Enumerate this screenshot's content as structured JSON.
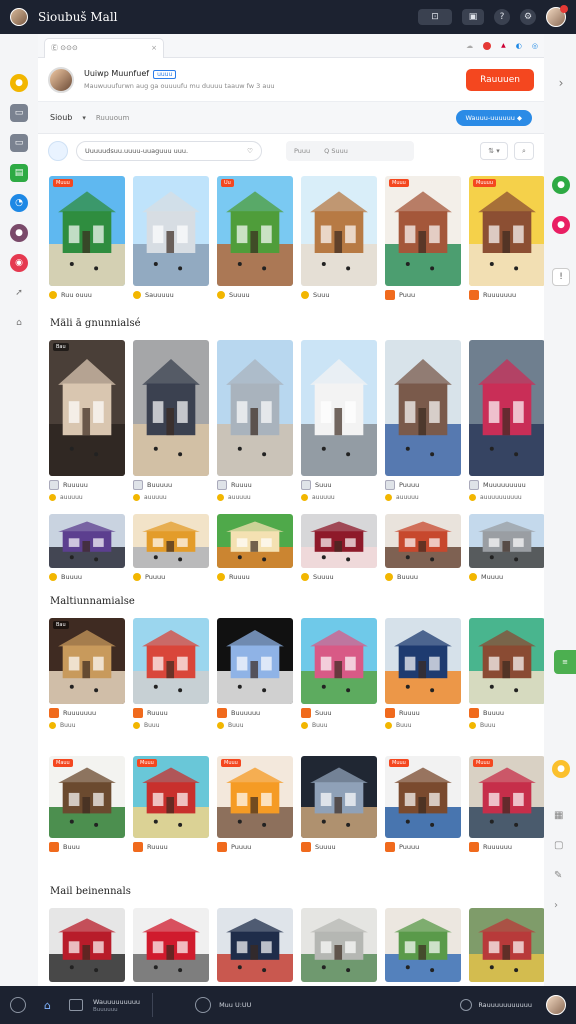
{
  "app": {
    "title": "Sioubuš Mall"
  },
  "topbar": {
    "btn1": "⊡",
    "btn2": "▣",
    "btn3": "?"
  },
  "tab": {
    "label": "Ⓔ ⊙⊙⊙",
    "close": "×"
  },
  "profile": {
    "name": "Uuiwp Muunfuef",
    "badge": "uuuu",
    "subtitle": "Mauwuuufurwn aug ga ouuuufu mu duuuu taauw fw 3 auu",
    "cta": "Rauuuen"
  },
  "subnav": {
    "selected": "Sioub",
    "second": "Ruuuoum",
    "pill": "Wauuu-uuuuuu"
  },
  "filters": {
    "search_placeholder": "Uuuuudsuu.uuuu-uuaguuu uuu.",
    "btn_a": "Puuu",
    "btn_b": "Q Suuu",
    "sort": "⇅ ▾",
    "search_icon": "⌕"
  },
  "row1": [
    {
      "tag": "Muuu",
      "label": "Ruu ouuu",
      "kind": "island",
      "icon": "coin"
    },
    {
      "tag": "",
      "label": "Sauuuuu",
      "kind": "city",
      "icon": "coin"
    },
    {
      "tag": "Uu",
      "label": "Suuuu",
      "kind": "tower",
      "icon": "coin"
    },
    {
      "tag": "",
      "label": "Suuu",
      "kind": "shop",
      "icon": "coin"
    },
    {
      "tag": "Muuu",
      "label": "Puuu",
      "kind": "market",
      "icon": "sq"
    },
    {
      "tag": "Muuuu",
      "label": "Ruuuuuuu",
      "kind": "stall",
      "icon": "sq"
    }
  ],
  "section1": "Mäli ā gnunnialsé",
  "row2": [
    {
      "tag": "Bau",
      "label": "Ruuuuu",
      "sub": "auuuuu",
      "kind": "mall-dark"
    },
    {
      "tag": "",
      "label": "Buuuuu",
      "sub": "auuuuu",
      "kind": "mall-front"
    },
    {
      "tag": "",
      "label": "Ruuuu",
      "sub": "auuuuu",
      "kind": "street"
    },
    {
      "tag": "",
      "label": "Suuu",
      "sub": "auuuuu",
      "kind": "church"
    },
    {
      "tag": "",
      "label": "Puuuu",
      "sub": "auuuuu",
      "kind": "plaza"
    },
    {
      "tag": "",
      "label": "Muuuuuuuuu",
      "sub": "auuuuuuuuuu",
      "kind": "grid"
    }
  ],
  "row3": [
    {
      "label": "Buuuu",
      "kind": "shop-a"
    },
    {
      "label": "Puuuu",
      "kind": "shop-b"
    },
    {
      "label": "Ruuuu",
      "kind": "shop-c"
    },
    {
      "label": "Suuuu",
      "kind": "shop-d"
    },
    {
      "label": "Buuuu",
      "kind": "shop-e"
    },
    {
      "label": "Muuuu",
      "kind": "shop-f"
    }
  ],
  "section2": "Maltiunnamialse",
  "row4": [
    {
      "tag": "Bau",
      "label": "Ruuuuuuu",
      "sub": "Buuu",
      "kind": "store-1"
    },
    {
      "tag": "",
      "label": "Ruuuu",
      "sub": "Buuu",
      "kind": "store-2"
    },
    {
      "tag": "",
      "label": "Buuuuuu",
      "sub": "Buuu",
      "kind": "kiosk"
    },
    {
      "tag": "",
      "label": "Suuu",
      "sub": "Buuu",
      "kind": "candy"
    },
    {
      "tag": "",
      "label": "Ruuuu",
      "sub": "Buuu",
      "kind": "store-5"
    },
    {
      "tag": "",
      "label": "Buuuu",
      "sub": "Buuu",
      "kind": "store-6"
    }
  ],
  "row5": [
    {
      "tag": "Mauu",
      "label": "Buuu",
      "kind": "booth"
    },
    {
      "tag": "Muuu",
      "label": "Ruuuu",
      "kind": "box"
    },
    {
      "tag": "Muuu",
      "label": "Puuuu",
      "kind": "orange"
    },
    {
      "tag": "",
      "label": "Suuuu",
      "kind": "dark-mall"
    },
    {
      "tag": "Muuu",
      "label": "Puuuu",
      "kind": "store-7"
    },
    {
      "tag": "Muuu",
      "label": "Ruuuuuu",
      "kind": "store-8"
    }
  ],
  "section3": "Mail beinennals",
  "row6": [
    {
      "kind": "front-1"
    },
    {
      "kind": "front-2"
    },
    {
      "kind": "front-3"
    },
    {
      "kind": "corridor"
    },
    {
      "kind": "crates"
    },
    {
      "kind": "crates2"
    }
  ],
  "bottombar": {
    "label1": "Wauuuuuuuuu",
    "label1b": "Buuuuuu",
    "label2": "Muu U:UU",
    "label3": "Rauuuuuuuuuuu"
  }
}
